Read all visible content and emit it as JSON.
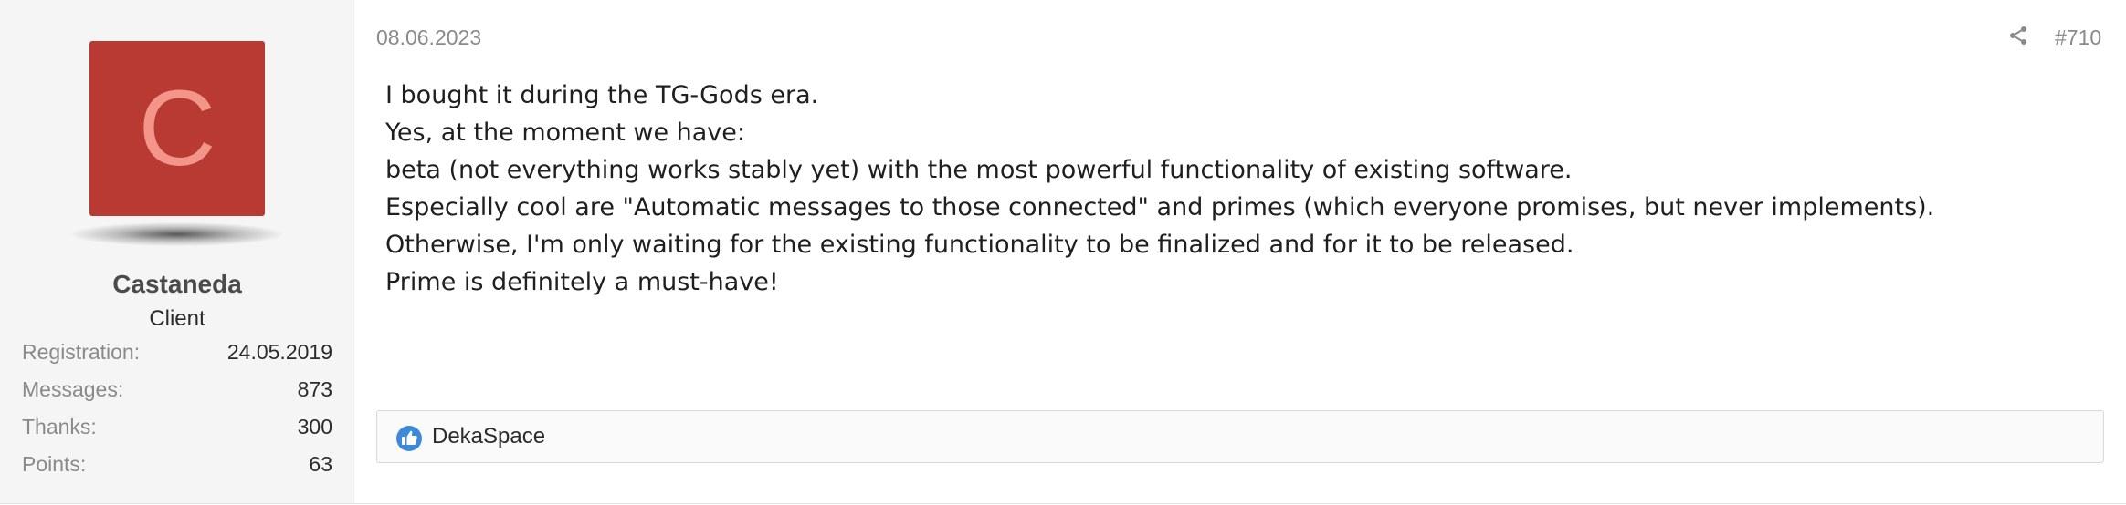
{
  "user": {
    "avatar_letter": "C",
    "avatar_color": "#b93a32",
    "avatar_letter_color": "#f4958a",
    "name": "Castaneda",
    "title": "Client",
    "stats": [
      {
        "label": "Registration:",
        "value": "24.05.2019"
      },
      {
        "label": "Messages:",
        "value": "873"
      },
      {
        "label": "Thanks:",
        "value": "300"
      },
      {
        "label": "Points:",
        "value": "63"
      }
    ]
  },
  "post": {
    "date": "08.06.2023",
    "share_icon": "share-icon",
    "number": "#710",
    "lines": [
      "I bought it during the TG-Gods era.",
      "Yes, at the moment we have:",
      "beta (not everything works stably yet) with the most powerful functionality of existing software.",
      "Especially cool are \"Automatic messages to those connected\" and primes (which everyone promises, but never implements).",
      "Otherwise, I'm only waiting for the existing functionality to be finalized and for it to be released.",
      "Prime is definitely a must-have!"
    ]
  },
  "reactions": {
    "icon": "like-icon",
    "icon_color": "#3d8bd8",
    "users": "DekaSpace"
  }
}
